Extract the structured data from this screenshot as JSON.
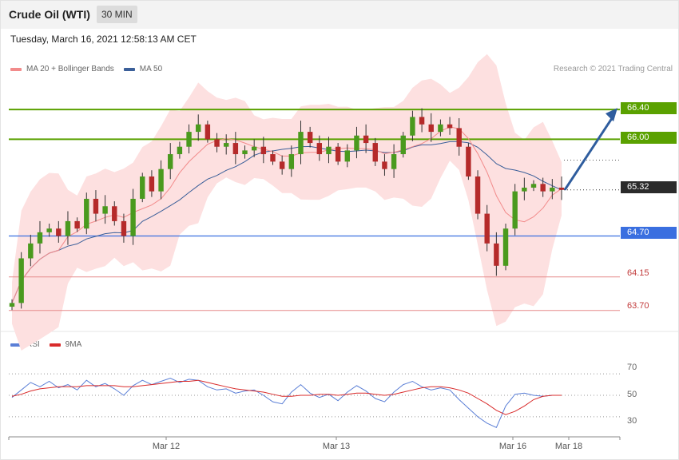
{
  "header": {
    "title": "Crude Oil (WTI)",
    "timeframe": "30 MIN"
  },
  "timestamp": "Tuesday, March 16, 2021 12:58:13 AM CET",
  "legend_main": [
    {
      "label": "MA 20 + Bollinger Bands",
      "color": "#f28b8b"
    },
    {
      "label": "MA 50",
      "color": "#3b5f99"
    }
  ],
  "credit": "Research © 2021 Trading Central",
  "legend_rsi": [
    {
      "label": "RSI",
      "color": "#5b7fd6"
    },
    {
      "label": "9MA",
      "color": "#d92b2b"
    }
  ],
  "levels": {
    "r2": "66.40",
    "r1": "66.00",
    "last": "65.32",
    "pivot": "64.70",
    "s1": "64.15",
    "s2": "63.70"
  },
  "rsi_ticks": [
    "70",
    "50",
    "30"
  ],
  "x_labels": [
    "Mar 12",
    "Mar 13",
    "Mar 16",
    "Mar 18"
  ],
  "colors": {
    "resistance": "#5aa100",
    "pivot": "#3a6fe0",
    "support": "#c23b3b",
    "up": "#4a9a1e",
    "down": "#b52a2a",
    "arrow": "#2f5d9e"
  },
  "chart_data": {
    "type": "candlestick",
    "ylim": [
      63.45,
      66.82
    ],
    "levels": {
      "resistance": [
        66.4,
        66.0
      ],
      "pivot": 64.7,
      "support": [
        64.15,
        63.7
      ],
      "last": 65.32
    },
    "projection": {
      "from": 65.32,
      "to": 66.4
    },
    "rsi_ylim": [
      15,
      85
    ],
    "rsi_levels": [
      70,
      50,
      30
    ],
    "price_path": [
      63.8,
      64.4,
      64.6,
      64.75,
      64.8,
      64.7,
      64.9,
      64.8,
      65.2,
      65.0,
      65.1,
      64.9,
      64.7,
      65.2,
      65.5,
      65.3,
      65.6,
      65.8,
      65.9,
      66.1,
      66.2,
      66.0,
      65.9,
      65.95,
      65.8,
      65.85,
      65.9,
      65.8,
      65.7,
      65.6,
      65.8,
      66.1,
      65.95,
      65.8,
      65.9,
      65.7,
      65.85,
      66.05,
      65.95,
      65.7,
      65.6,
      65.8,
      66.05,
      66.3,
      66.2,
      66.1,
      66.2,
      66.15,
      65.9,
      65.5,
      65.0,
      64.6,
      64.3,
      64.8,
      65.3,
      65.35,
      65.4,
      65.3,
      65.35,
      65.32
    ],
    "rsi": [
      48,
      55,
      62,
      58,
      63,
      57,
      60,
      55,
      64,
      58,
      61,
      56,
      50,
      59,
      64,
      60,
      63,
      66,
      62,
      65,
      64,
      58,
      55,
      56,
      52,
      54,
      55,
      50,
      44,
      42,
      53,
      60,
      52,
      48,
      51,
      45,
      53,
      59,
      54,
      47,
      44,
      53,
      60,
      63,
      58,
      55,
      57,
      55,
      46,
      38,
      30,
      24,
      20,
      40,
      51,
      52,
      50,
      49,
      50,
      50
    ],
    "rsi_ma": [
      49,
      51,
      54,
      56,
      57,
      58,
      58,
      58,
      59,
      59,
      59,
      59,
      58,
      58,
      59,
      60,
      61,
      62,
      63,
      63,
      64,
      62,
      60,
      58,
      56,
      55,
      54,
      53,
      51,
      49,
      49,
      50,
      50,
      51,
      51,
      50,
      51,
      52,
      52,
      51,
      50,
      51,
      53,
      55,
      57,
      58,
      58,
      57,
      55,
      52,
      47,
      42,
      36,
      32,
      35,
      40,
      46,
      49,
      50,
      50
    ]
  }
}
